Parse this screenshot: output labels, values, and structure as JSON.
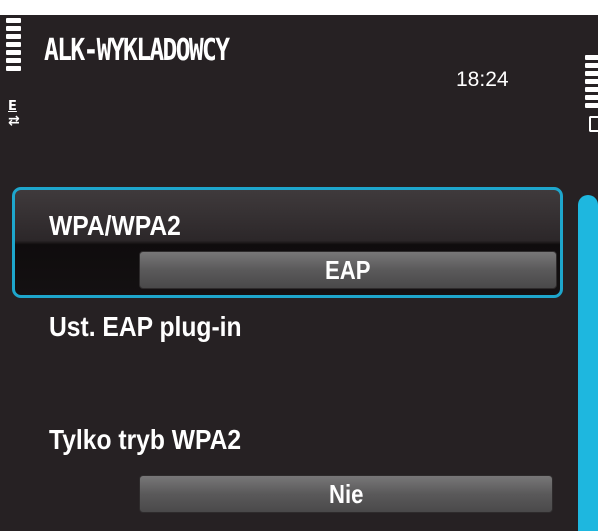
{
  "header": {
    "title": "ALK-WYKLADOWCY",
    "time": "18:24",
    "network_mode": "E",
    "network_arrows": "⇄"
  },
  "settings": [
    {
      "label": "WPA/WPA2",
      "value": "EAP",
      "focused": true
    },
    {
      "label": "Ust. EAP plug-in"
    },
    {
      "label": "Tylko tryb WPA2",
      "value": "Nie"
    }
  ],
  "colors": {
    "background": "#262123",
    "focus_border": "#1ea6cc",
    "scrollbar": "#1eb7df",
    "text": "#ffffff"
  },
  "icons": {
    "signal": "signal-strength-icon",
    "network": "network-e-icon",
    "battery": "battery-icon"
  }
}
